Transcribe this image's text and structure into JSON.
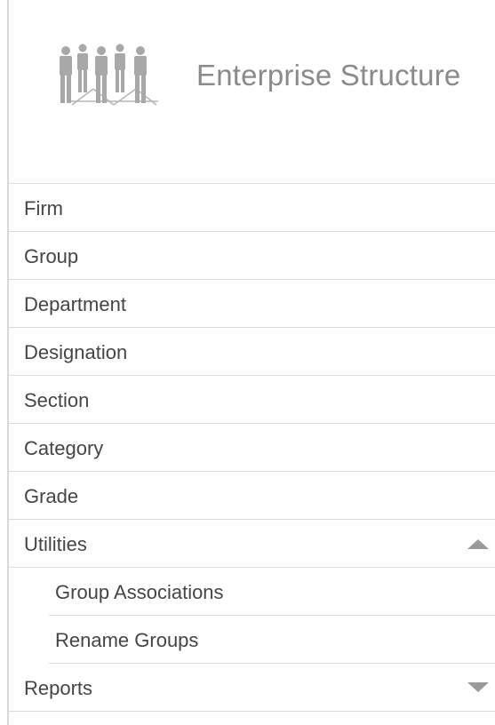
{
  "header": {
    "title": "Enterprise Structure",
    "icon": "people-group-icon"
  },
  "menu": {
    "items": [
      {
        "label": "Firm"
      },
      {
        "label": "Group"
      },
      {
        "label": "Department"
      },
      {
        "label": "Designation"
      },
      {
        "label": "Section"
      },
      {
        "label": "Category"
      },
      {
        "label": "Grade"
      },
      {
        "label": "Utilities",
        "expanded": true,
        "icon": "chevron-up-icon"
      },
      {
        "label": "Group Associations",
        "submenu": true
      },
      {
        "label": "Rename Groups",
        "submenu": true
      },
      {
        "label": "Reports",
        "expanded": false,
        "icon": "chevron-down-icon"
      }
    ]
  },
  "colors": {
    "text": "#454545",
    "title": "#8a8a8a",
    "divider": "#dcdcdc",
    "icon": "#9a9a9a"
  }
}
